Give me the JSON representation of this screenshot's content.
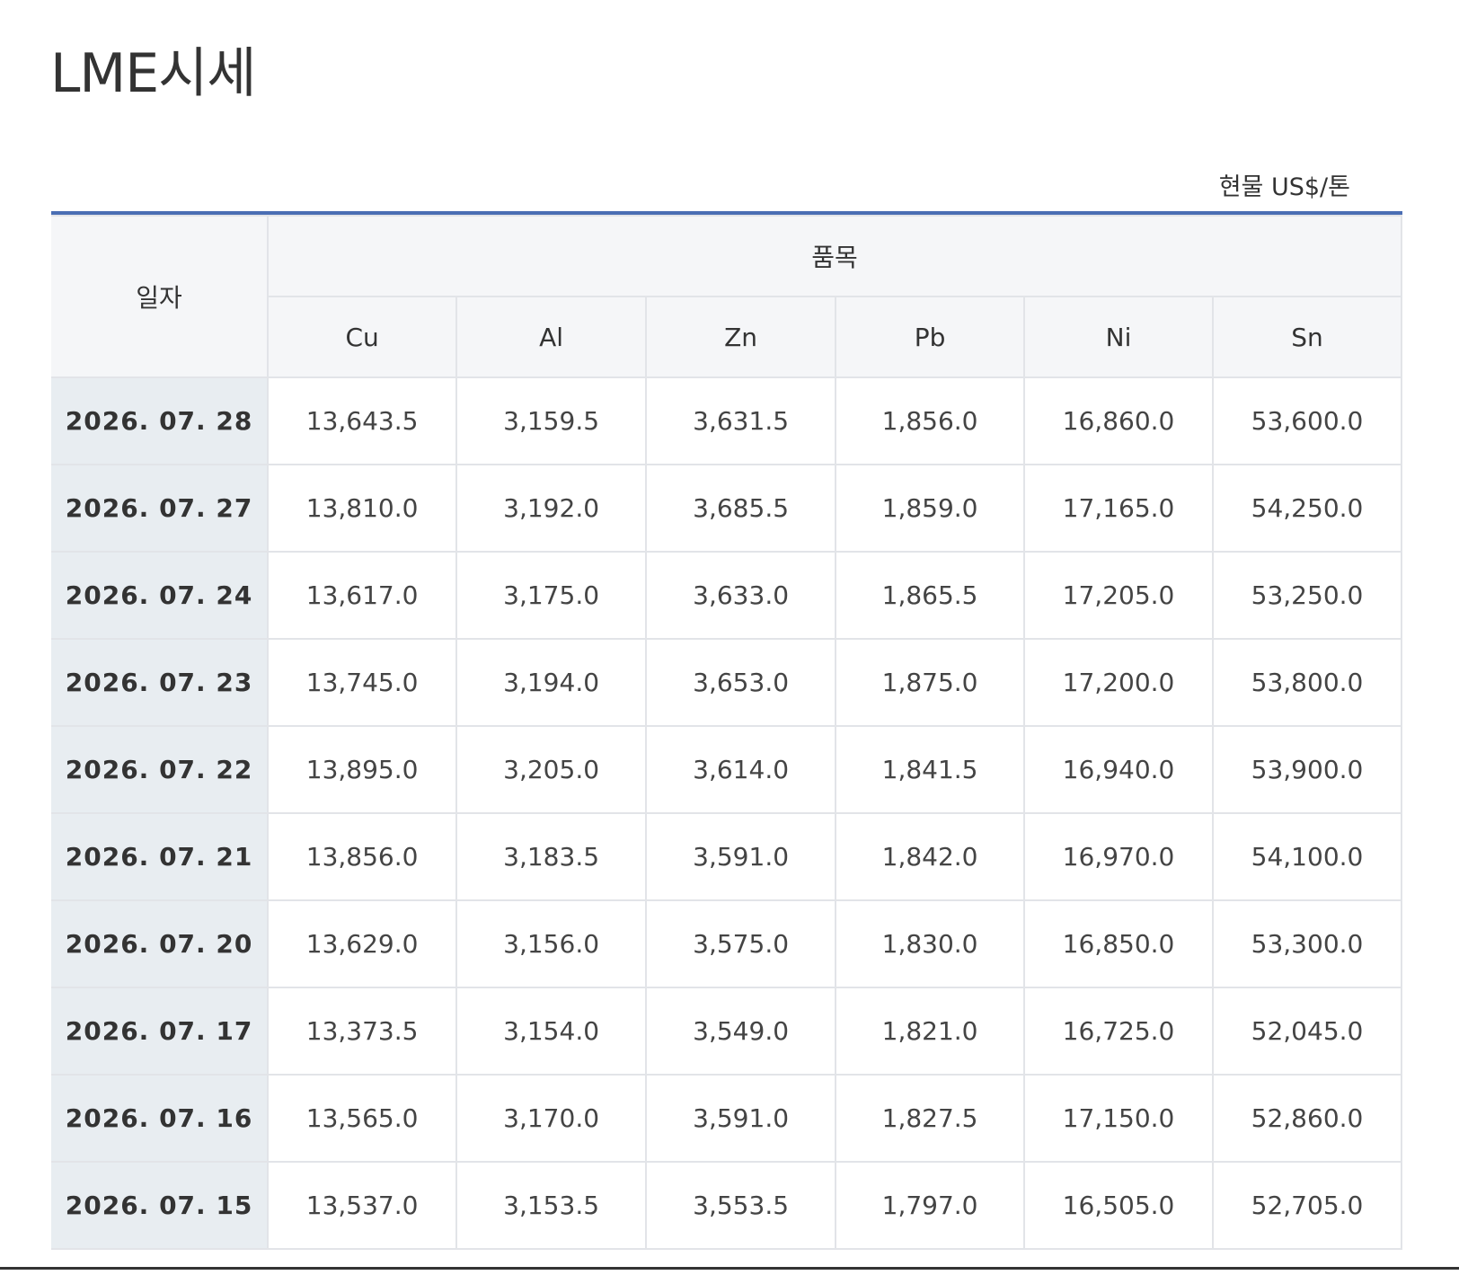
{
  "page": {
    "title": "LME시세",
    "unit_note": "현물 US$/톤"
  },
  "table": {
    "date_header": "일자",
    "group_header": "품목",
    "columns": [
      "Cu",
      "Al",
      "Zn",
      "Pb",
      "Ni",
      "Sn"
    ],
    "rows": [
      {
        "date": "2026. 07. 28",
        "values": [
          "13,643.5",
          "3,159.5",
          "3,631.5",
          "1,856.0",
          "16,860.0",
          "53,600.0"
        ]
      },
      {
        "date": "2026. 07. 27",
        "values": [
          "13,810.0",
          "3,192.0",
          "3,685.5",
          "1,859.0",
          "17,165.0",
          "54,250.0"
        ]
      },
      {
        "date": "2026. 07. 24",
        "values": [
          "13,617.0",
          "3,175.0",
          "3,633.0",
          "1,865.5",
          "17,205.0",
          "53,250.0"
        ]
      },
      {
        "date": "2026. 07. 23",
        "values": [
          "13,745.0",
          "3,194.0",
          "3,653.0",
          "1,875.0",
          "17,200.0",
          "53,800.0"
        ]
      },
      {
        "date": "2026. 07. 22",
        "values": [
          "13,895.0",
          "3,205.0",
          "3,614.0",
          "1,841.5",
          "16,940.0",
          "53,900.0"
        ]
      },
      {
        "date": "2026. 07. 21",
        "values": [
          "13,856.0",
          "3,183.5",
          "3,591.0",
          "1,842.0",
          "16,970.0",
          "54,100.0"
        ]
      },
      {
        "date": "2026. 07. 20",
        "values": [
          "13,629.0",
          "3,156.0",
          "3,575.0",
          "1,830.0",
          "16,850.0",
          "53,300.0"
        ]
      },
      {
        "date": "2026. 07. 17",
        "values": [
          "13,373.5",
          "3,154.0",
          "3,549.0",
          "1,821.0",
          "16,725.0",
          "52,045.0"
        ]
      },
      {
        "date": "2026. 07. 16",
        "values": [
          "13,565.0",
          "3,170.0",
          "3,591.0",
          "1,827.5",
          "17,150.0",
          "52,860.0"
        ]
      },
      {
        "date": "2026. 07. 15",
        "values": [
          "13,537.0",
          "3,153.5",
          "3,553.5",
          "1,797.0",
          "16,505.0",
          "52,705.0"
        ]
      }
    ]
  },
  "colors": {
    "accent_border": "#4a6eb4",
    "header_bg": "#f5f6f8",
    "date_cell_bg": "#e8edf1"
  }
}
